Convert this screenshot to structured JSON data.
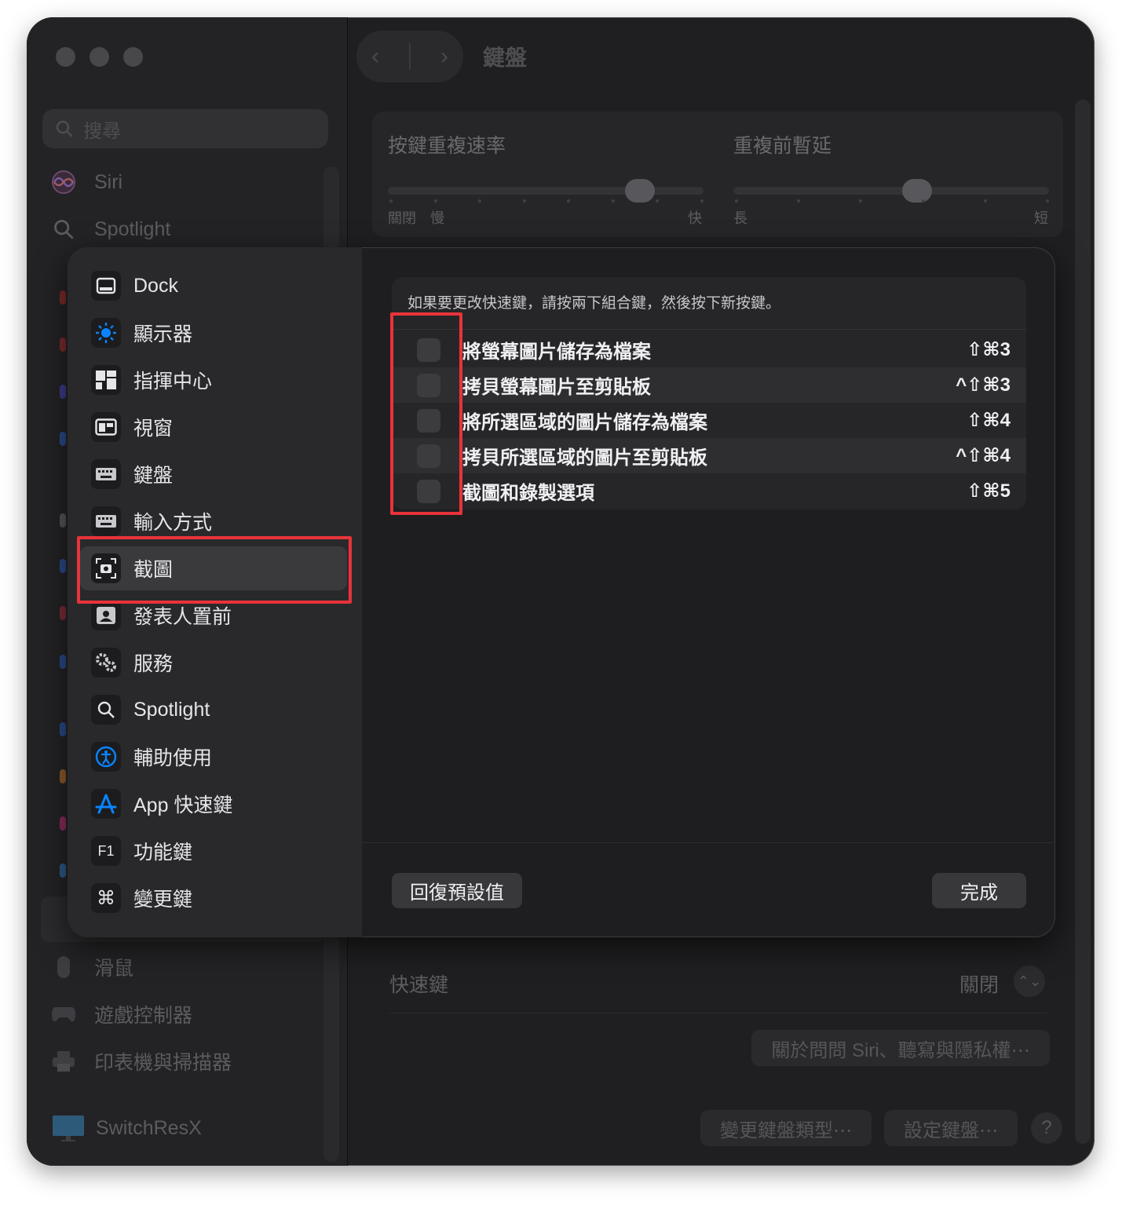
{
  "window": {
    "title": "鍵盤"
  },
  "search": {
    "placeholder": "搜尋"
  },
  "sidebar": {
    "top_items": [
      {
        "label": "Siri",
        "icon": "siri-icon"
      },
      {
        "label": "Spotlight",
        "icon": "magnifier-icon"
      }
    ],
    "bottom_items": [
      {
        "label": "滑鼠",
        "icon": "mouse-icon"
      },
      {
        "label": "遊戲控制器",
        "icon": "gamepad-icon"
      },
      {
        "label": "印表機與掃描器",
        "icon": "printer-icon"
      },
      {
        "label": "SwitchResX",
        "icon": "display-icon"
      }
    ]
  },
  "keyboard": {
    "repeat_rate": {
      "label": "按鍵重複速率",
      "left1": "關閉",
      "left2": "慢",
      "right": "快",
      "level": 0.83
    },
    "delay": {
      "label": "重複前暫延",
      "left": "長",
      "right": "短",
      "level": 0.59
    },
    "shortcuts": {
      "label": "快速鍵",
      "value": "關閉"
    },
    "siri_privacy_button": "關於問問 Siri、聽寫與隱私權⋯",
    "change_type_button": "變更鍵盤類型⋯",
    "setup_button": "設定鍵盤⋯",
    "help": "?"
  },
  "modal": {
    "categories": [
      {
        "label": "Dock",
        "icon": "dock-icon"
      },
      {
        "label": "顯示器",
        "icon": "brightness-icon"
      },
      {
        "label": "指揮中心",
        "icon": "mission-control-icon"
      },
      {
        "label": "視窗",
        "icon": "window-icon"
      },
      {
        "label": "鍵盤",
        "icon": "keyboard-icon"
      },
      {
        "label": "輸入方式",
        "icon": "input-method-icon"
      },
      {
        "label": "截圖",
        "icon": "screenshot-icon",
        "selected": true
      },
      {
        "label": "發表人置前",
        "icon": "presenter-icon"
      },
      {
        "label": "服務",
        "icon": "gears-icon"
      },
      {
        "label": "Spotlight",
        "icon": "magnifier-icon"
      },
      {
        "label": "輔助使用",
        "icon": "accessibility-icon"
      },
      {
        "label": "App 快速鍵",
        "icon": "app-store-icon"
      },
      {
        "label": "功能鍵",
        "icon": "f1-icon",
        "glyph": "F1"
      },
      {
        "label": "變更鍵",
        "icon": "command-icon",
        "glyph": "⌘"
      }
    ],
    "hint": "如果要更改快速鍵，請按兩下組合鍵，然後按下新按鍵。",
    "shortcuts": [
      {
        "label": "將螢幕圖片儲存為檔案",
        "keys": "⇧⌘3",
        "checked": false
      },
      {
        "label": "拷貝螢幕圖片至剪貼板",
        "keys": "^⇧⌘3",
        "checked": false
      },
      {
        "label": "將所選區域的圖片儲存為檔案",
        "keys": "⇧⌘4",
        "checked": false
      },
      {
        "label": "拷貝所選區域的圖片至剪貼板",
        "keys": "^⇧⌘4",
        "checked": false
      },
      {
        "label": "截圖和錄製選項",
        "keys": "⇧⌘5",
        "checked": false
      }
    ],
    "restore_defaults": "回復預設值",
    "done": "完成"
  },
  "colors": {
    "highlight": "#e8333a",
    "accent": "#0a84ff"
  }
}
